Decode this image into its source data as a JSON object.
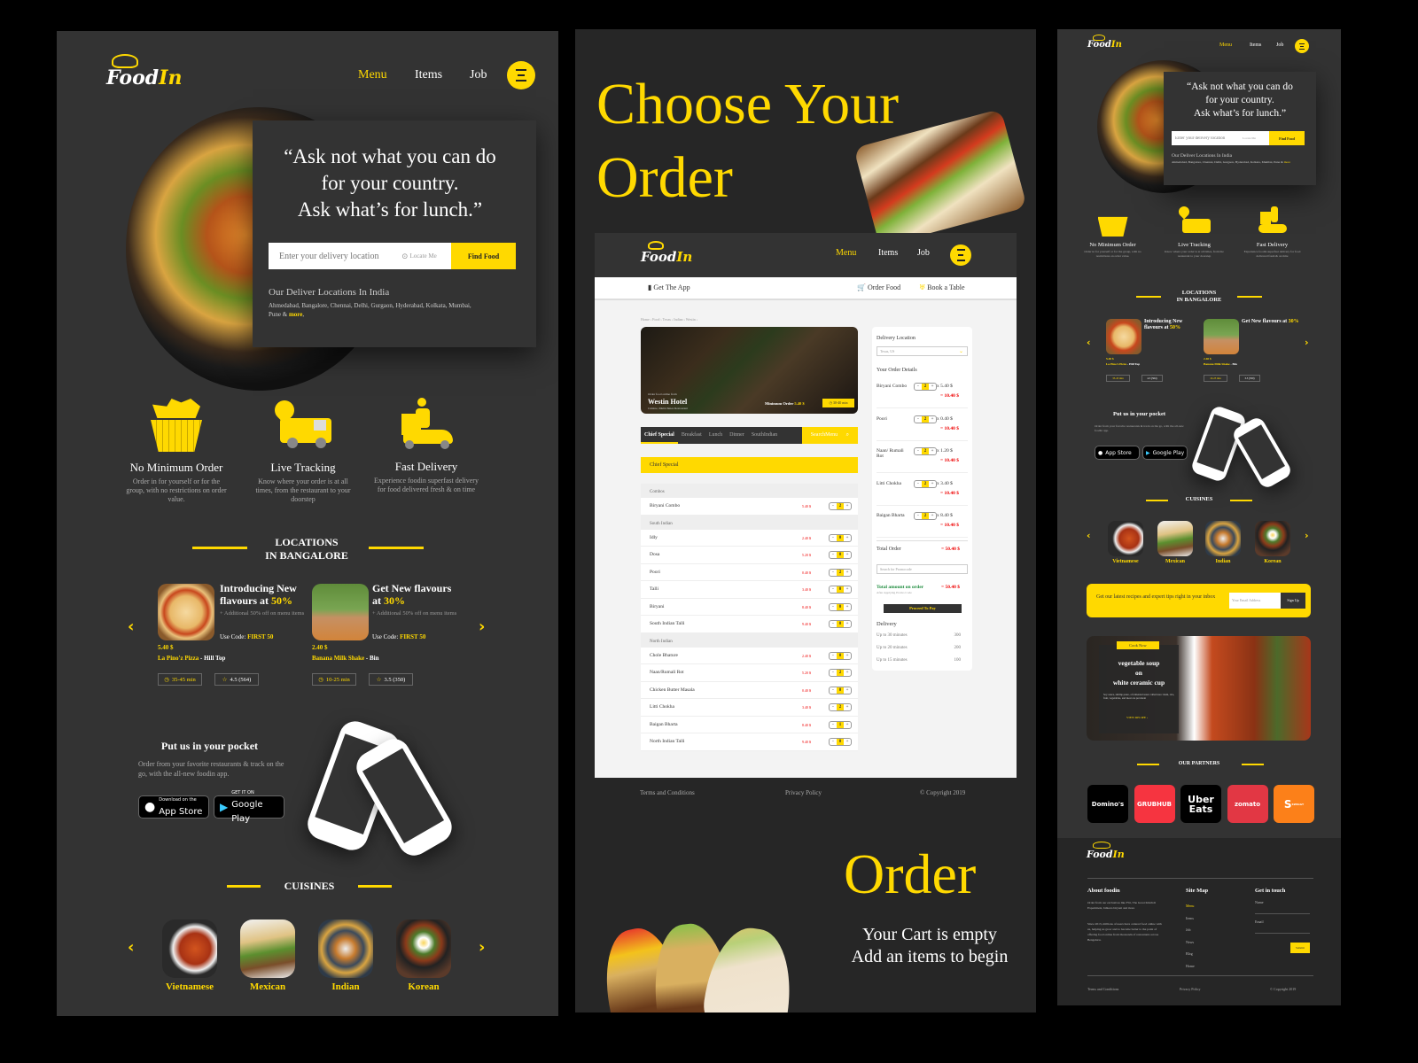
{
  "brand": {
    "logo_main": "Food",
    "logo_accent": "In"
  },
  "nav": {
    "items": [
      "Menu",
      "Items",
      "Job"
    ],
    "active": "Menu"
  },
  "hero": {
    "quote_lines": [
      "“Ask not what you can do",
      "for your country.",
      "Ask what’s for lunch.”"
    ],
    "search_placeholder": "Enter your delivery location",
    "locate_label": "Locate Me",
    "find_button": "Find Food",
    "locations_title": "Our Deliver Locations In India",
    "locations_text": "Ahmedabad, Bangalore, Chennai, Delhi, Gurgaon, Hyderabad, Kolkata, Mumbai, Pune &",
    "more_link": "more",
    "more_suffix": ","
  },
  "features": [
    {
      "icon": "basket-icon",
      "title": "No Minimum Order",
      "desc": "Order in for yourself or for the group, with no restrictions on order value."
    },
    {
      "icon": "delivery-truck-icon",
      "title": "Live Tracking",
      "desc": "Know where your order is at all times, from the restaurant to your doorstep"
    },
    {
      "icon": "scooter-icon",
      "title": "Fast Delivery",
      "desc": "Experience foodin superfast delivery for food delivered fresh & on time"
    }
  ],
  "locations_section": {
    "line1": "LOCATIONS",
    "line2": "IN BANGALORE"
  },
  "offers": [
    {
      "title_pre": "Introducing New flavours at ",
      "pct": "50%",
      "sub": "+ Additional 50% off on menu items",
      "code_label": "Use Code: ",
      "code": "FIRST 50",
      "price": "5.40 $",
      "item": "La Pino'z Pizza",
      "place": " - Hill Top",
      "time": "35-45 min",
      "rating": "4.5 (564)"
    },
    {
      "title_pre": "Get New flavours at ",
      "pct": "30%",
      "sub": "+ Additional 50% off on menu items",
      "code_label": "Use Code: ",
      "code": "FIRST 50",
      "price": "2.40 $",
      "item": "Banana Milk Shake",
      "place": " - Bin",
      "time": "10-25 min",
      "rating": "3.5 (350)"
    }
  ],
  "app_promo": {
    "title": "Put us in your pocket",
    "desc": "Order from your favorite restaurants & track on the go, with the all-new foodin app.",
    "appstore_small": "Download on the",
    "appstore_big": "App Store",
    "gplay_small": "GET IT ON",
    "gplay_big": "Google Play"
  },
  "cuisines_title": "CUISINES",
  "cuisines": [
    "Vietnamese",
    "Mexican",
    "Indian",
    "Korean"
  ],
  "middle": {
    "headline_1": "Choose Your",
    "headline_2": "Order",
    "subnav_left": "Get The App",
    "subnav_order": "Order Food",
    "subnav_table": "Book a Table",
    "breadcrumb": [
      "Home",
      "Food",
      "Texas",
      "Indian",
      "Westin"
    ],
    "restaurant": {
      "kicker": "Order food online from",
      "name": "Westin Hotel",
      "cuisine": "Cuisine, Multichines Restaurant",
      "min_label": "Minimum Order",
      "min_value": "5.40 $",
      "time": "30-40 min"
    },
    "tabs": [
      "Chief Special",
      "Breakfast",
      "Lunch",
      "Dinner",
      "SouthIndian"
    ],
    "search_menu": "SearchMenu",
    "menu_header": "Chief Special",
    "menu": [
      {
        "category": "Combos",
        "items": [
          {
            "name": "Biryani Combo",
            "price": "5.40 $",
            "qty": "2"
          }
        ]
      },
      {
        "category": "South Indian",
        "items": [
          {
            "name": "Idly",
            "price": "2.40 $",
            "qty": "0"
          },
          {
            "name": "Dosa",
            "price": "5.20 $",
            "qty": "0"
          },
          {
            "name": "Poori",
            "price": "0.40 $",
            "qty": "2"
          },
          {
            "name": "Talli",
            "price": "3.40 $",
            "qty": "0"
          },
          {
            "name": "Biryani",
            "price": "8.40 $",
            "qty": "0"
          },
          {
            "name": "South Indian Talli",
            "price": "9.40 $",
            "qty": "0"
          }
        ]
      },
      {
        "category": "North Indian",
        "items": [
          {
            "name": "Chole Bhature",
            "price": "2.40 $",
            "qty": "0"
          },
          {
            "name": "Naan/Rumali Rot",
            "price": "5.20 $",
            "qty": "2"
          },
          {
            "name": "Chicken Butter Masala",
            "price": "0.40 $",
            "qty": "0"
          },
          {
            "name": "Litti Chokha",
            "price": "3.40 $",
            "qty": "2"
          },
          {
            "name": "Baigan Bharta",
            "price": "8.40 $",
            "qty": "1"
          },
          {
            "name": "North Indian Talli",
            "price": "9.40 $",
            "qty": "0"
          }
        ]
      }
    ],
    "order": {
      "delivery_label": "Delivery Location",
      "delivery_value": "Texas, US",
      "details_label": "Your Order Details",
      "items": [
        {
          "name": "Biryani Combo",
          "qty": "2",
          "unit": "x 5.40 $",
          "total": "= 10.40 $"
        },
        {
          "name": "Poori",
          "qty": "2",
          "unit": "x 0.40 $",
          "total": "= 10.40 $"
        },
        {
          "name": "Naan/ Rumali Rot",
          "qty": "2",
          "unit": "x 1.20 $",
          "total": "= 10.40 $"
        },
        {
          "name": "Litti Chokha",
          "qty": "2",
          "unit": "x 3.40 $",
          "total": "= 10.40 $"
        },
        {
          "name": "Baigan Bharta",
          "qty": "2",
          "unit": "x 8.40 $",
          "total": "= 10.40 $"
        }
      ],
      "total_label": "Total Order",
      "total_value": "= 50.40 $",
      "promo_placeholder": "Search for Promocode",
      "amount_label": "Total amount on order",
      "amount_note": "After Applying Promo Code",
      "amount_value": "= 50.40 $",
      "pay_button": "Proceed To Pay",
      "delivery_title": "Delivery",
      "delivery_options": [
        {
          "label": "Up to 30 minutes",
          "value": "300"
        },
        {
          "label": "Up to 20 minutes",
          "value": "200"
        },
        {
          "label": "Up to 15 minutes",
          "value": "100"
        }
      ]
    },
    "footer": {
      "terms": "Terms and Conditions",
      "privacy": "Privacy Policy",
      "copyright": "© Copyright 2019"
    },
    "order_big": "Order",
    "empty_1": "Your Cart is empty",
    "empty_2": "Add an items to begin"
  },
  "right": {
    "newsletter_text": "Get our latest recipes and expert tips right in your inbox",
    "email_placeholder": "Your Email Address",
    "signup": "Sign Up",
    "recipe": {
      "badge": "Cook Now",
      "title_lines": [
        "vegetable soup",
        "on",
        "white ceramic cup"
      ],
      "desc": "Soy sauce, shrimp paste, a fermented sauce called nuoc mam, rice, fruit, vegetables, and meat are prevalent",
      "link": "VIEW RECIPE"
    },
    "partners_title": "OUR PARTNERS",
    "partners": [
      {
        "name": "Domino's",
        "color": "#000000"
      },
      {
        "name": "GRUBHUB",
        "color": "#f63440"
      },
      {
        "name": "Uber Eats",
        "color": "#000000"
      },
      {
        "name": "zomato",
        "color": "#e23744"
      },
      {
        "name": "SWIGGY",
        "color": "#fc8019"
      }
    ],
    "footer": {
      "about_title": "About foodin",
      "about_p1": "Order from our exclusives like Flrt, The Great Khichdi Experiment, Ishkara biryani and more",
      "about_p2": "Since 2013, millions of users have ordered food online with us, helping us grow and to become better to the point of offering food online from thousands of restaurants across Bengaluru.",
      "sitemap_title": "Site Map",
      "sitemap": [
        "Menu",
        "Items",
        "Job",
        "News",
        "Blog",
        "Home"
      ],
      "touch_title": "Get in touch",
      "name_label": "Name",
      "email_label": "Email",
      "submit": "Submit",
      "terms": "Terms and Conditions",
      "privacy": "Privacy Policy",
      "copyright": "© Copyright 2019"
    }
  },
  "colors": {
    "accent": "#ffd900",
    "panel": "#333333",
    "price_red": "#e00000",
    "success_green": "#1a8a3a"
  }
}
